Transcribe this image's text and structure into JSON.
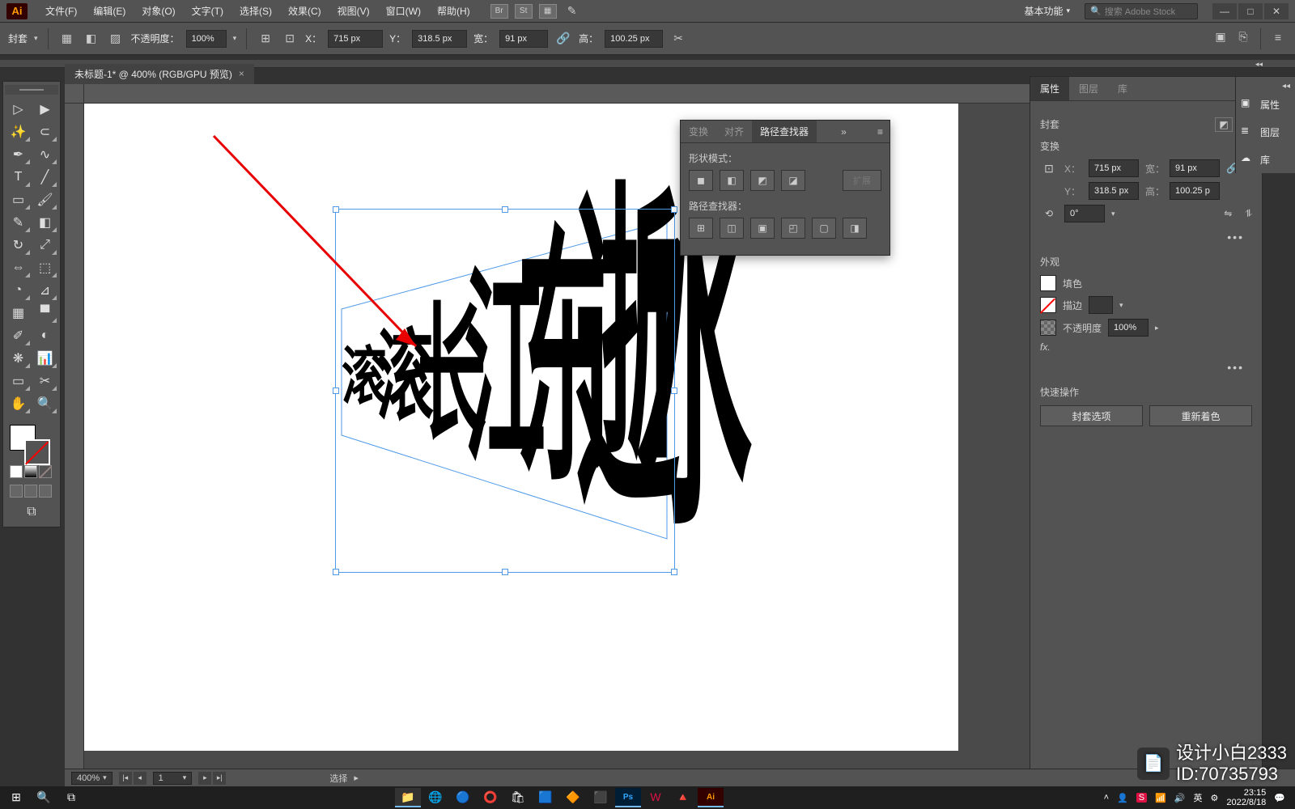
{
  "menubar": {
    "items": [
      "文件(F)",
      "编辑(E)",
      "对象(O)",
      "文字(T)",
      "选择(S)",
      "效果(C)",
      "视图(V)",
      "窗口(W)",
      "帮助(H)"
    ],
    "workspace": "基本功能",
    "search_placeholder": "搜索 Adobe Stock"
  },
  "options": {
    "object_type": "封套",
    "opacity_label": "不透明度：",
    "opacity_value": "100%",
    "x_label": "X：",
    "x_value": "715 px",
    "y_label": "Y：",
    "y_value": "318.5 px",
    "w_label": "宽：",
    "w_value": "91 px",
    "h_label": "高：",
    "h_value": "100.25 px"
  },
  "document_tab": "未标题-1* @ 400% (RGB/GPU 预览)",
  "canvas_text": "滚滚长江东逝水",
  "pathfinder_panel": {
    "tabs": [
      "变换",
      "对齐",
      "路径查找器"
    ],
    "shape_modes_label": "形状模式：",
    "expand_label": "扩展",
    "pathfinders_label": "路径查找器："
  },
  "properties_panel": {
    "tabs": [
      "属性",
      "图层",
      "库"
    ],
    "selection_type": "封套",
    "transform_title": "变换",
    "x_label": "X：",
    "x_value": "715 px",
    "y_label": "Y：",
    "y_value": "318.5 px",
    "w_label": "宽：",
    "w_value": "91 px",
    "h_label": "高：",
    "h_value": "100.25 p",
    "rotation": "0°",
    "appearance_title": "外观",
    "fill_label": "填色",
    "stroke_label": "描边",
    "opacity_label": "不透明度",
    "opacity_value": "100%",
    "fx_label": "fx.",
    "quick_title": "快速操作",
    "btn_envelope": "封套选项",
    "btn_recolor": "重新着色"
  },
  "right_strip": {
    "properties": "属性",
    "layers": "图层",
    "libraries": "库"
  },
  "status": {
    "zoom": "400%",
    "artboard": "1",
    "tool": "选择"
  },
  "taskbar": {
    "time": "23:15",
    "date": "2022/8/18",
    "ime": "英"
  },
  "watermark": {
    "name": "设计小白2333",
    "id": "ID:70735793"
  }
}
